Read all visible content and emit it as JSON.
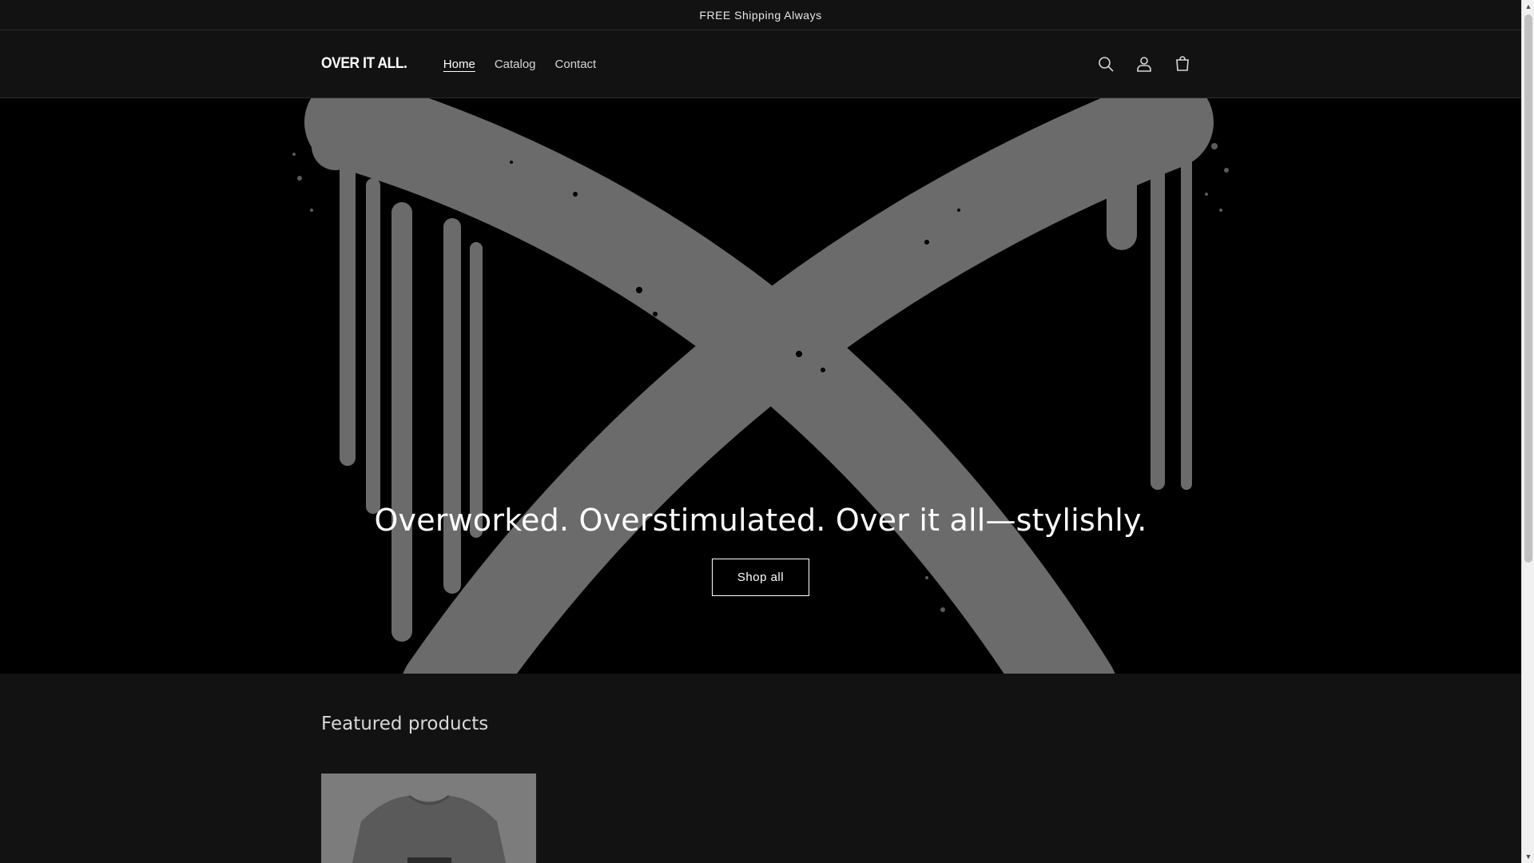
{
  "announcement": {
    "text": "FREE Shipping Always"
  },
  "header": {
    "logo": "OVER IT ALL.",
    "nav": [
      {
        "label": "Home",
        "active": true
      },
      {
        "label": "Catalog",
        "active": false
      },
      {
        "label": "Contact",
        "active": false
      }
    ],
    "icons": [
      "search-icon",
      "account-icon",
      "cart-icon"
    ]
  },
  "hero": {
    "title": "Overworked. Overstimulated. Over it all—stylishly.",
    "button_label": "Shop all"
  },
  "featured": {
    "title": "Featured products"
  },
  "colors": {
    "background": "#121212",
    "hero_background": "#000000",
    "hero_art": "#6b6b6b",
    "text": "#ffffff"
  }
}
